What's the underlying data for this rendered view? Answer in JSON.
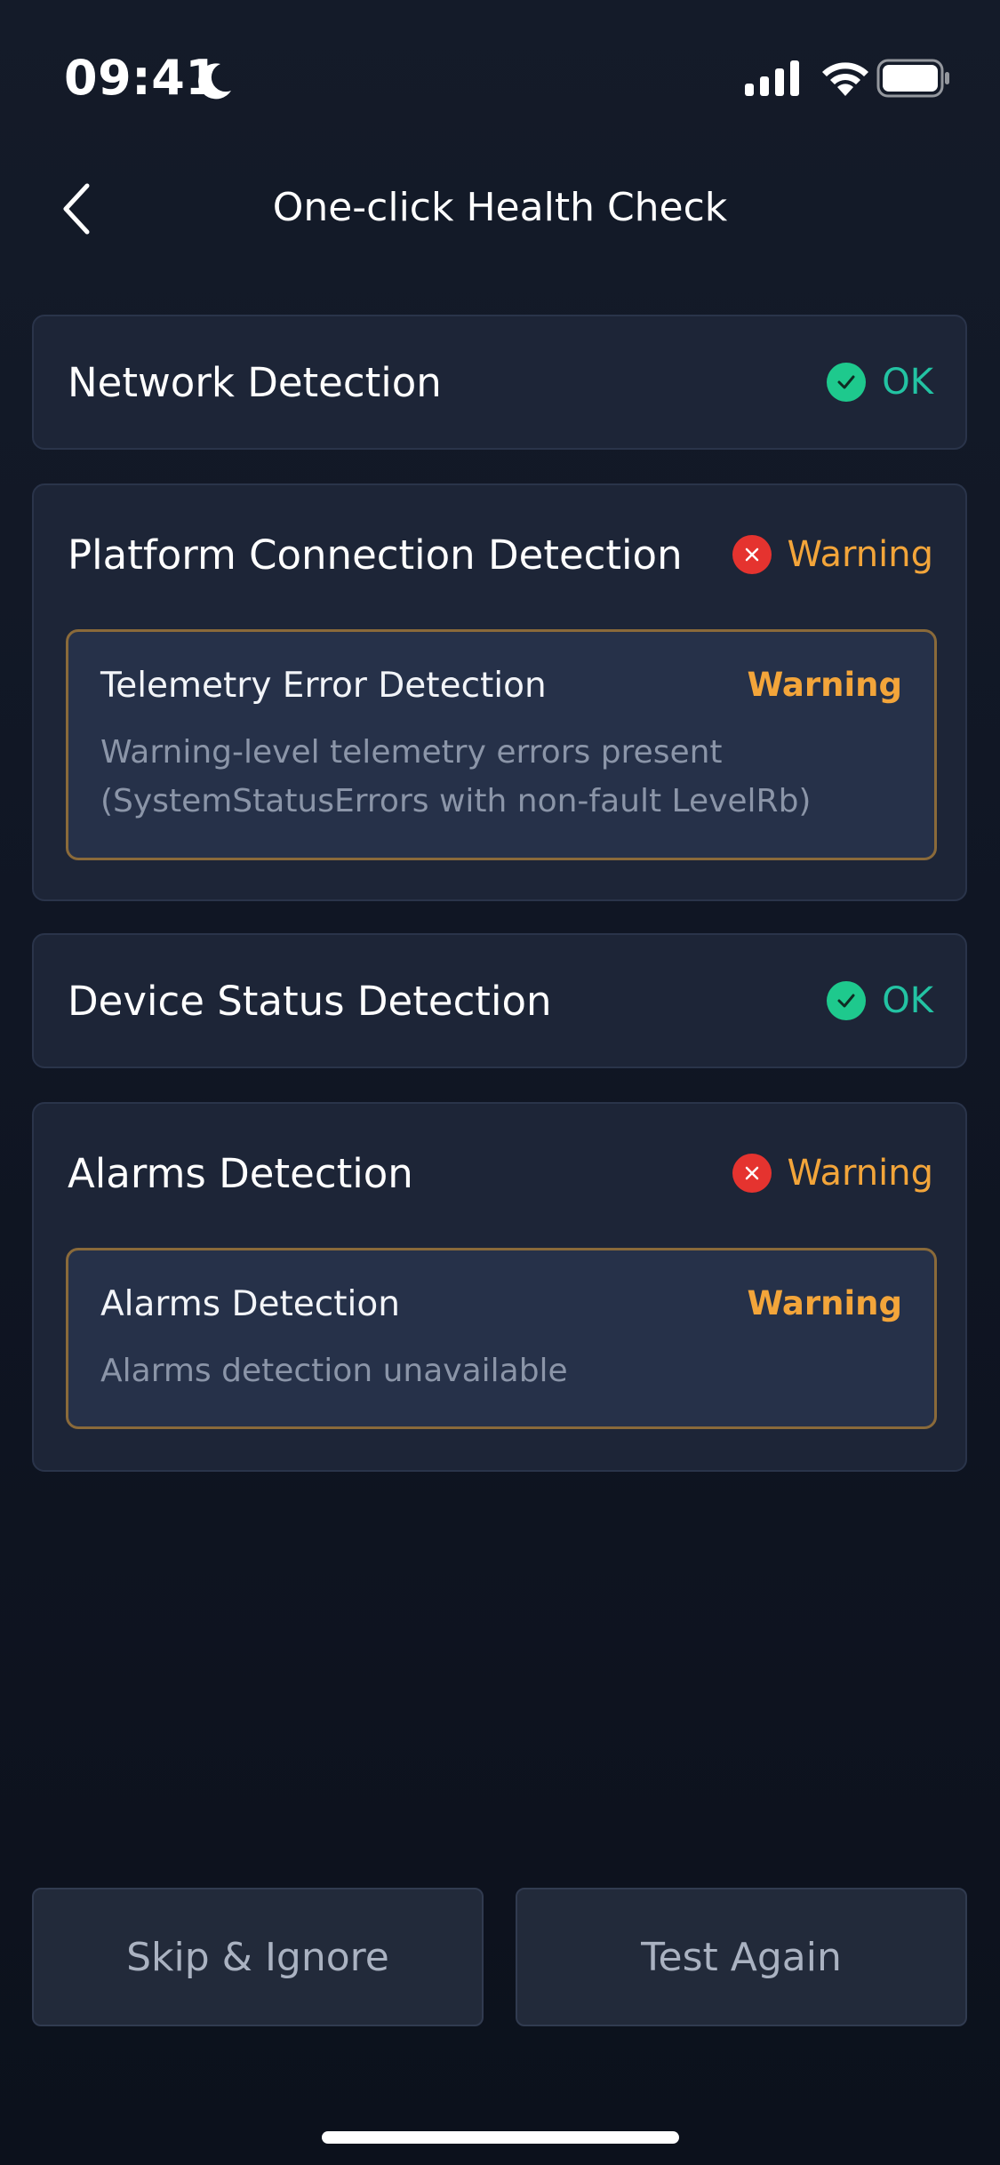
{
  "status_bar": {
    "time": "09:41"
  },
  "nav": {
    "title": "One-click Health Check"
  },
  "sections": [
    {
      "title": "Network Detection",
      "status": "OK"
    },
    {
      "title": "Platform Connection Detection",
      "status": "Warning",
      "detail": {
        "title": "Telemetry Error Detection",
        "status": "Warning",
        "desc_line1": "Warning-level telemetry errors present",
        "desc_line2": "(SystemStatusErrors with non-fault LevelRb)"
      }
    },
    {
      "title": "Device Status Detection",
      "status": "OK"
    },
    {
      "title": "Alarms Detection",
      "status": "Warning",
      "detail": {
        "title": "Alarms Detection",
        "status": "Warning",
        "desc_line1": "Alarms detection unavailable"
      }
    }
  ],
  "buttons": {
    "skip": "Skip & Ignore",
    "retest": "Test Again"
  },
  "colors": {
    "ok": "#23c3a3",
    "warning": "#f3a53a",
    "error_dot": "#e5332f",
    "ok_dot": "#1ec98d"
  }
}
